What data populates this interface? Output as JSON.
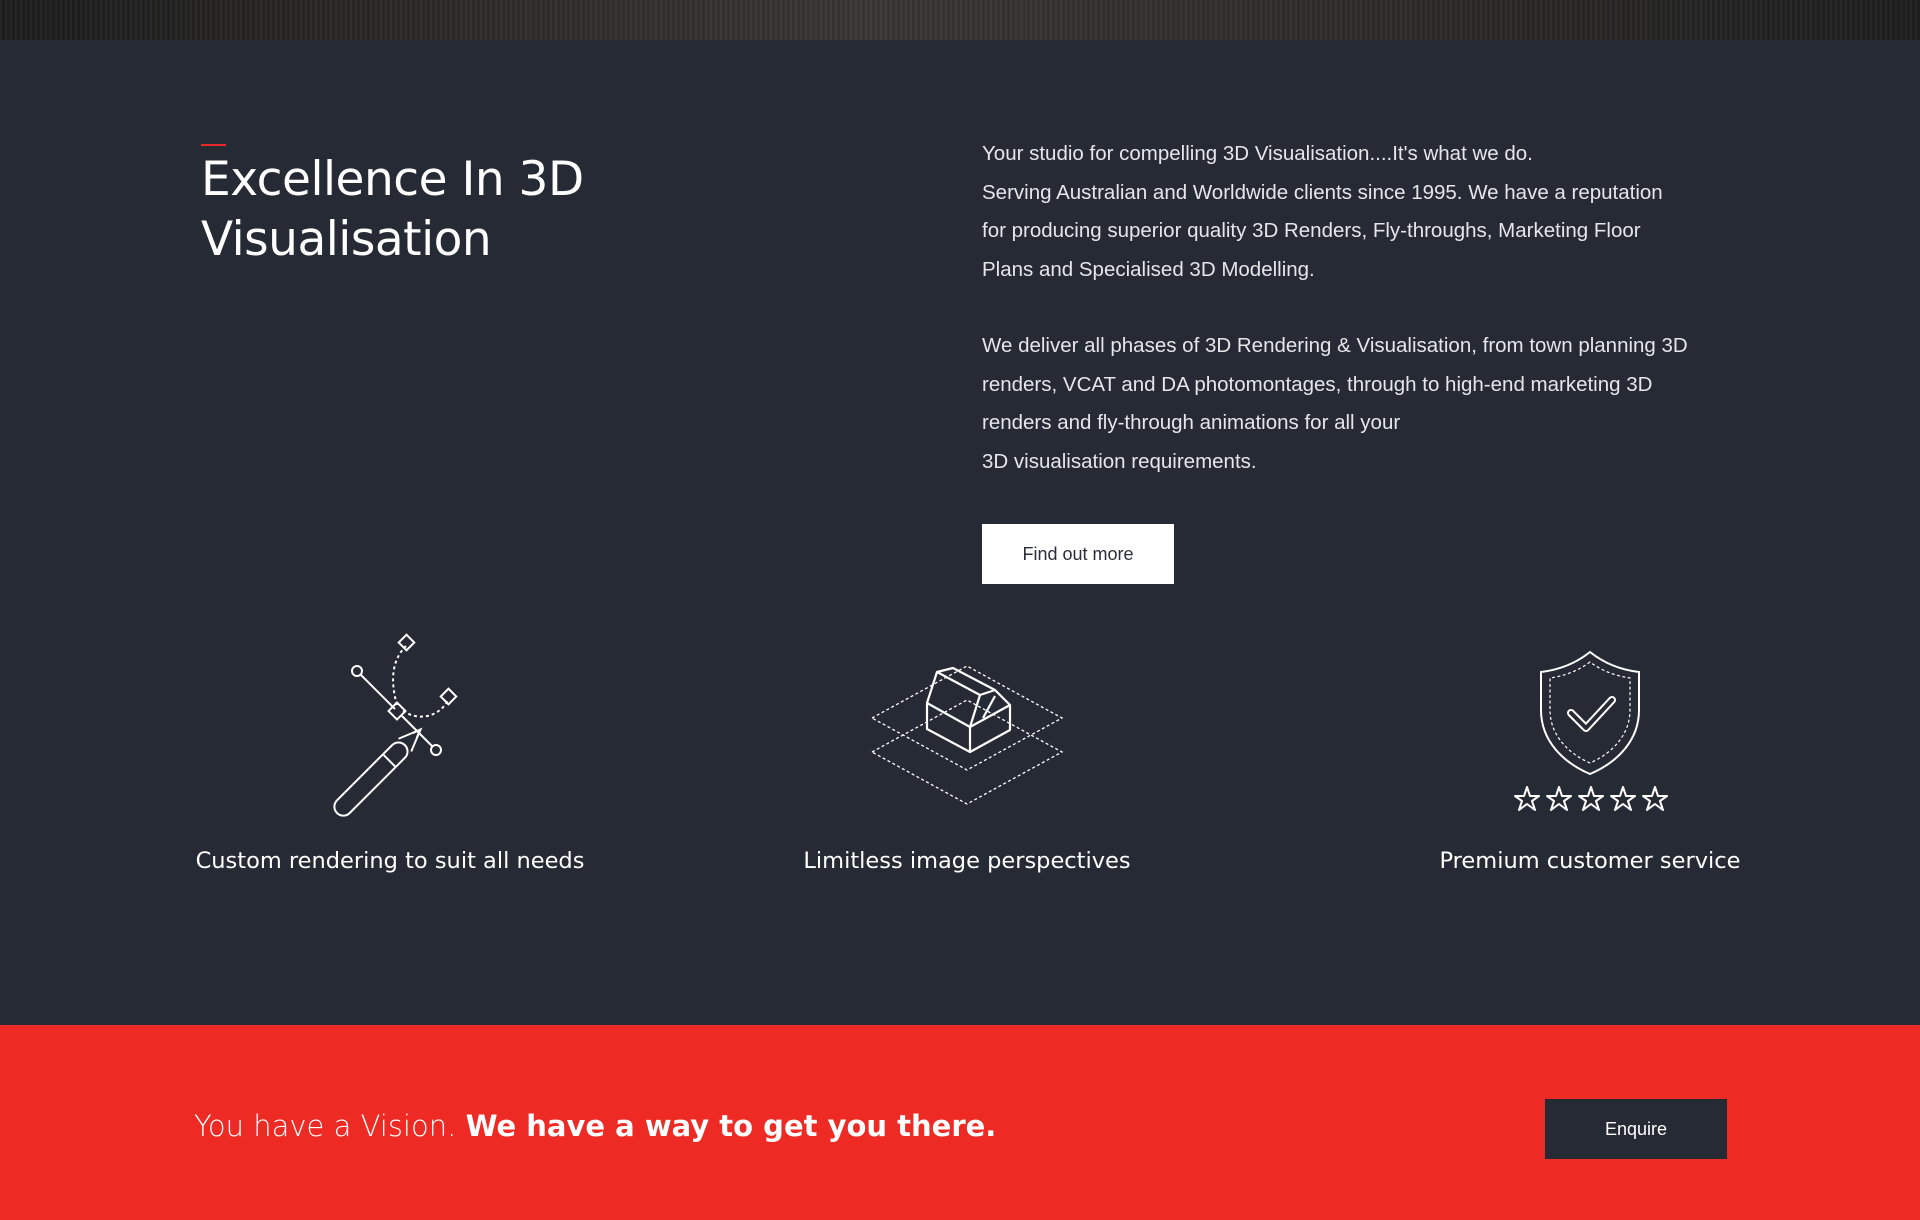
{
  "hero": {
    "icon": "aerial-photo-strip"
  },
  "about": {
    "heading_line1": "Excellence In 3D",
    "heading_line2": "Visualisation",
    "intro_lines": [
      "Your studio for compelling 3D Visualisation....It's what we do.",
      "Serving Australian and Worldwide clients since 1995. We have a reputation",
      "for producing superior quality 3D Renders, Fly-throughs, Marketing Floor",
      "Plans and Specialised 3D Modelling."
    ],
    "detail_lines": [
      "We deliver all phases of 3D Rendering & Visualisation, from town planning 3D",
      "renders, VCAT and DA photomontages, through to high-end marketing 3D",
      "renders and fly-through animations for all your",
      "3D visualisation requirements."
    ],
    "button_label": "Find out more",
    "accent_color": "#e8292a"
  },
  "features": [
    {
      "icon": "pen-tool-icon",
      "label": "Custom rendering to suit all needs"
    },
    {
      "icon": "isometric-house-layers-icon",
      "label": "Limitless image perspectives"
    },
    {
      "icon": "shield-check-stars-icon",
      "label": "Premium customer service"
    }
  ],
  "cta": {
    "text_light": "You have a Vision. ",
    "text_bold": "We have a way to get you there.",
    "button_label": "Enquire",
    "background_color": "#ee2a24"
  },
  "colors": {
    "page_bg": "#252a35",
    "text": "#ffffff"
  }
}
